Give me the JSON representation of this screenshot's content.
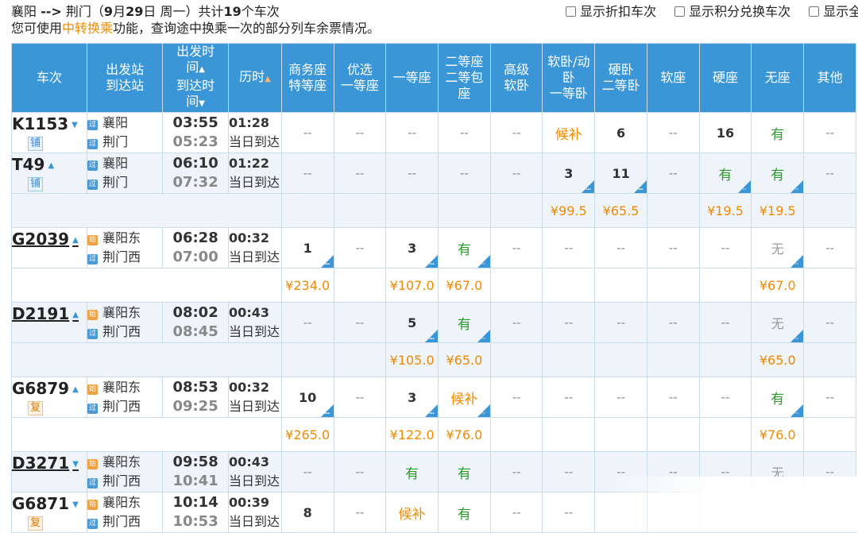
{
  "summary": {
    "from": "襄阳",
    "arrow": "-->",
    "to": "荆门",
    "date_open": "（",
    "month": "9",
    "month_sep": "月",
    "day": "29",
    "day_sep": "日",
    "weekday": "周一）",
    "count_prefix": "共计",
    "count": "19",
    "count_suffix": "个车次"
  },
  "hint": {
    "prefix": "您可使用",
    "link": "中转换乘",
    "suffix": "功能，查询途中换乘一次的部分列车余票情况。"
  },
  "filters": [
    "显示折扣车次",
    "显示积分兑换车次",
    "显示全部"
  ],
  "headers": {
    "code": "车次",
    "station_1": "出发站",
    "station_2": "到达站",
    "time_1": "出发时",
    "time_2": "间",
    "time_3": "到达时",
    "time_4": "间",
    "duration": "历时",
    "business_1": "商务座",
    "business_2": "特等座",
    "premium_1": "优选",
    "premium_2": "一等座",
    "first": "一等座",
    "second_1": "二等座",
    "second_2": "二等包",
    "second_3": "座",
    "deluxe_1": "高级",
    "deluxe_2": "软卧",
    "soft_1": "软卧/动",
    "soft_2": "卧",
    "soft_3": "一等卧",
    "hard_1": "硬卧",
    "hard_2": "二等卧",
    "softseat": "软座",
    "hardseat": "硬座",
    "noseat": "无座",
    "other": "其他"
  },
  "trains": [
    {
      "code": "K1153",
      "sort": "▼",
      "underline": false,
      "tag": "铺",
      "from_icon": "过",
      "from": "襄阳",
      "to_icon": "过",
      "to": "荆门",
      "dep": "03:55",
      "arr": "05:23",
      "dur": "01:28",
      "arrive_note": "当日到达",
      "cells": [
        "--",
        "--",
        "--",
        "--",
        "--",
        "候补",
        "6",
        "--",
        "16",
        "有",
        "--"
      ],
      "prices": null
    },
    {
      "code": "T49",
      "sort": "▲",
      "underline": false,
      "tag": "铺",
      "from_icon": "过",
      "from": "襄阳",
      "to_icon": "过",
      "to": "荆门",
      "dep": "06:10",
      "arr": "07:32",
      "dur": "01:22",
      "arrive_note": "当日到达",
      "cells": [
        "--",
        "--",
        "--",
        "--",
        "--",
        "3",
        "11",
        "--",
        "有",
        "有",
        "--"
      ],
      "prices": [
        "",
        "",
        "",
        "",
        "",
        "¥99.5",
        "¥65.5",
        "",
        "¥19.5",
        "¥19.5",
        ""
      ]
    },
    {
      "code": "G2039",
      "sort": "▲",
      "underline": true,
      "tag": "",
      "from_icon": "始",
      "from": "襄阳东",
      "to_icon": "过",
      "to": "荆门西",
      "dep": "06:28",
      "arr": "07:00",
      "dur": "00:32",
      "arrive_note": "当日到达",
      "cells": [
        "1",
        "--",
        "3",
        "有",
        "--",
        "--",
        "--",
        "--",
        "--",
        "无",
        "--"
      ],
      "prices": [
        "¥234.0",
        "",
        "¥107.0",
        "¥67.0",
        "",
        "",
        "",
        "",
        "",
        "¥67.0",
        ""
      ]
    },
    {
      "code": "D2191",
      "sort": "▲",
      "underline": true,
      "tag": "",
      "from_icon": "始",
      "from": "襄阳东",
      "to_icon": "过",
      "to": "荆门西",
      "dep": "08:02",
      "arr": "08:45",
      "dur": "00:43",
      "arrive_note": "当日到达",
      "cells": [
        "--",
        "--",
        "5",
        "有",
        "--",
        "--",
        "--",
        "--",
        "--",
        "无",
        "--"
      ],
      "prices": [
        "",
        "",
        "¥105.0",
        "¥65.0",
        "",
        "",
        "",
        "",
        "",
        "¥65.0",
        ""
      ]
    },
    {
      "code": "G6879",
      "sort": "▲",
      "underline": false,
      "tag": "复",
      "from_icon": "始",
      "from": "襄阳东",
      "to_icon": "过",
      "to": "荆门西",
      "dep": "08:53",
      "arr": "09:25",
      "dur": "00:32",
      "arrive_note": "当日到达",
      "cells": [
        "10",
        "--",
        "3",
        "候补",
        "--",
        "--",
        "--",
        "--",
        "--",
        "有",
        "--"
      ],
      "prices": [
        "¥265.0",
        "",
        "¥122.0",
        "¥76.0",
        "",
        "",
        "",
        "",
        "",
        "¥76.0",
        ""
      ]
    },
    {
      "code": "D3271",
      "sort": "▼",
      "underline": true,
      "tag": "",
      "from_icon": "始",
      "from": "襄阳东",
      "to_icon": "过",
      "to": "荆门西",
      "dep": "09:58",
      "arr": "10:41",
      "dur": "00:43",
      "arrive_note": "当日到达",
      "cells": [
        "--",
        "--",
        "有",
        "有",
        "--",
        "--",
        "--",
        "--",
        "--",
        "无",
        "--"
      ],
      "prices": null
    },
    {
      "code": "G6871",
      "sort": "▼",
      "underline": false,
      "tag": "复",
      "from_icon": "始",
      "from": "襄阳东",
      "to_icon": "过",
      "to": "荆门西",
      "dep": "10:14",
      "arr": "10:53",
      "dur": "00:39",
      "arrive_note": "当日到达",
      "cells": [
        "8",
        "--",
        "候补",
        "有",
        "--",
        "--",
        "",
        "",
        "",
        "",
        ""
      ],
      "prices": null
    }
  ],
  "colors": {
    "header": "#3a96d6",
    "available": "#2a9a2a",
    "waitlist": "#f08a00",
    "price": "#f08a00"
  }
}
